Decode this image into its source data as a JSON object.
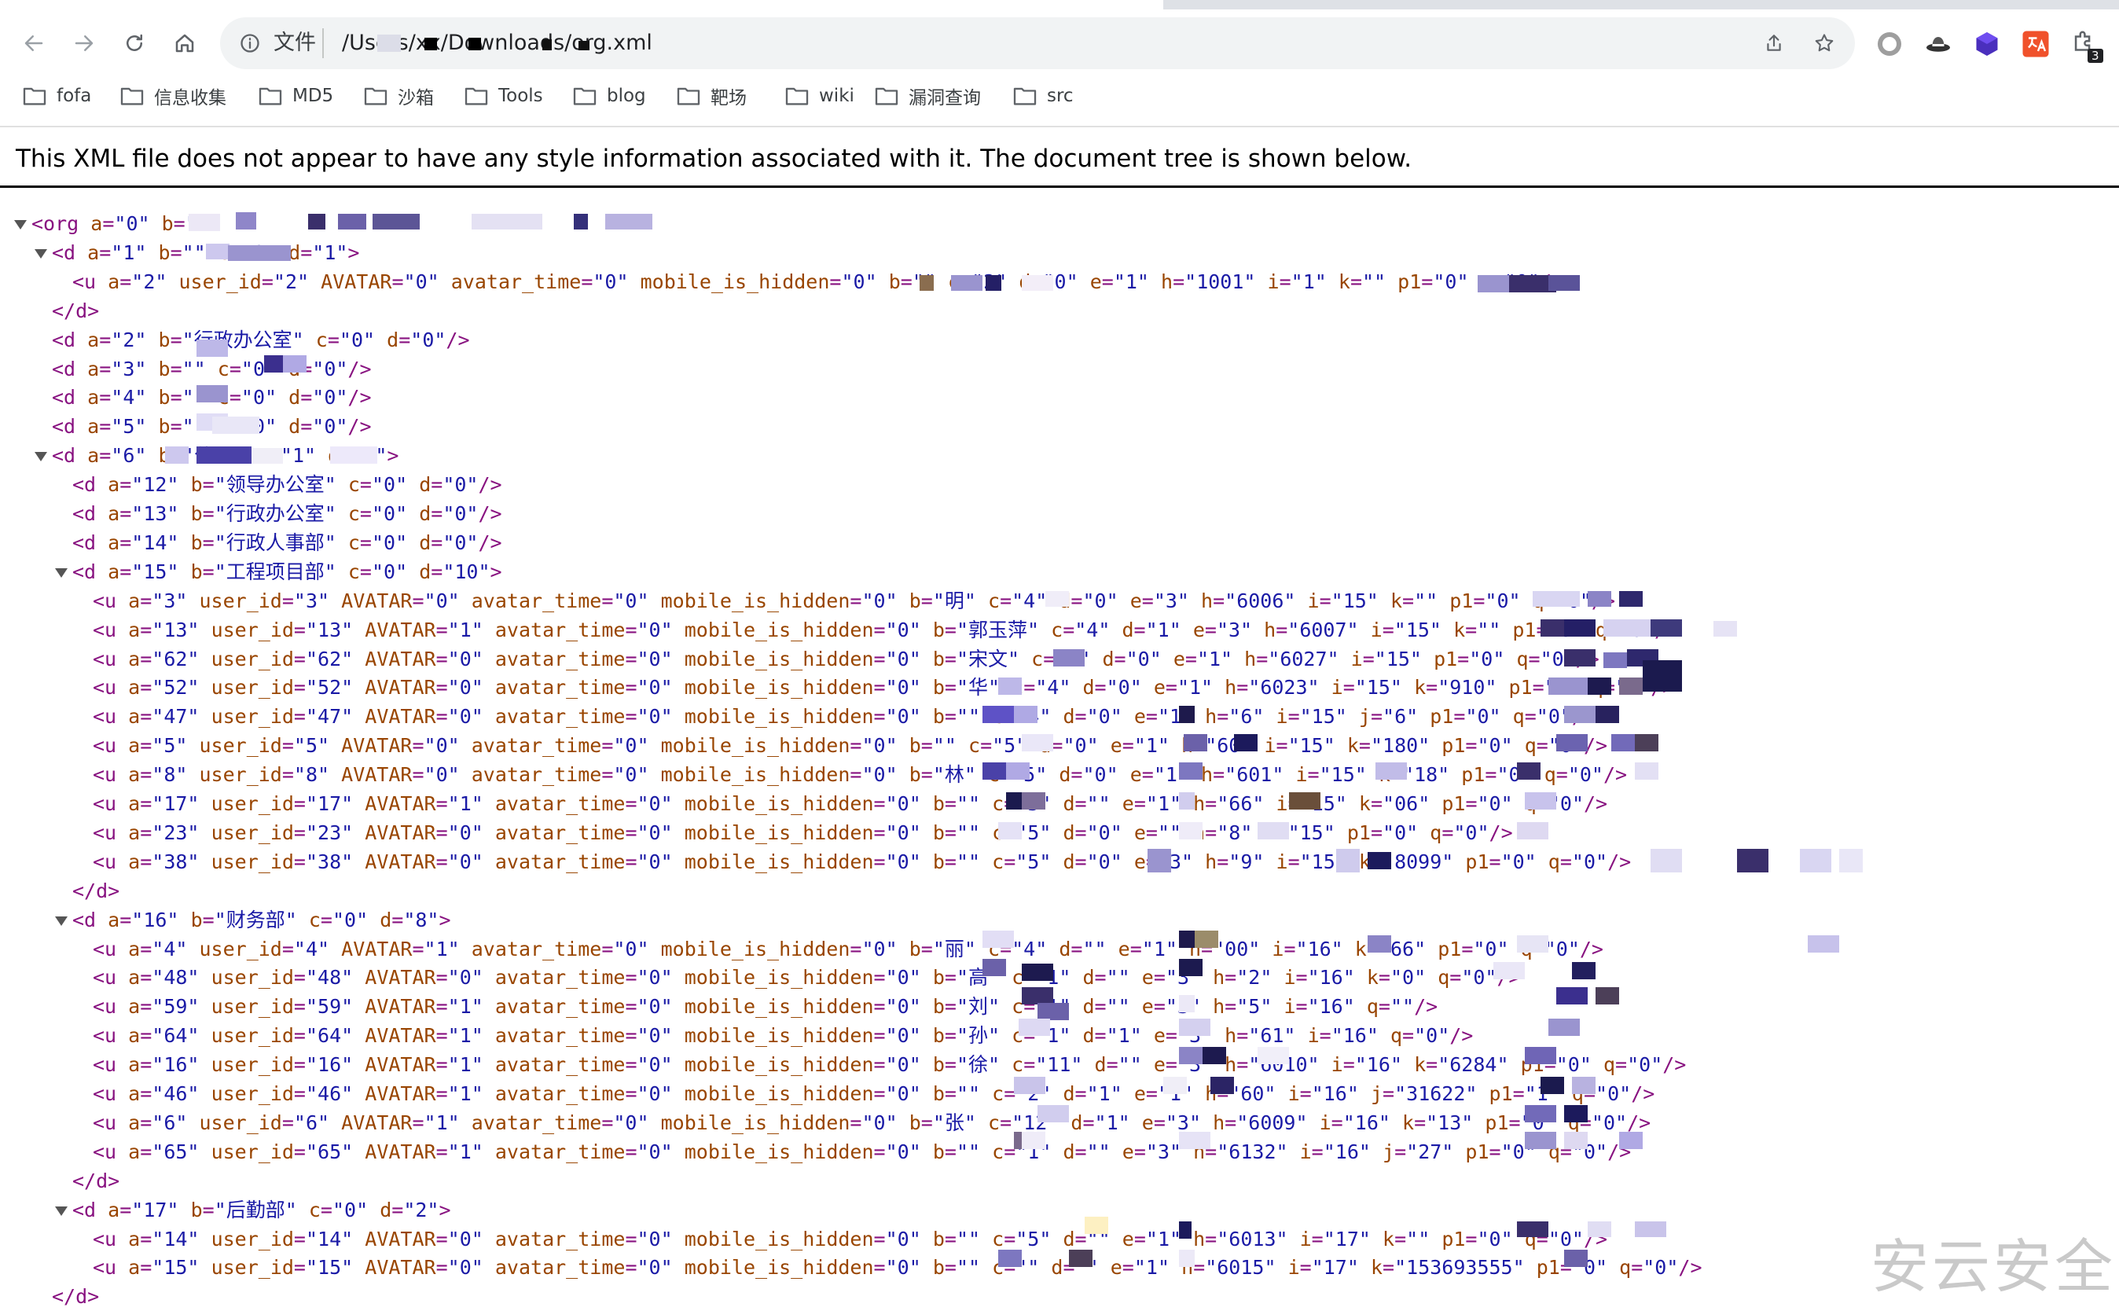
{
  "browser": {
    "omnibox": {
      "scheme_label": "文件",
      "url": "/Users/xx/Downloads/org.xml"
    },
    "bookmarks": [
      "fofa",
      "信息收集",
      "MD5",
      "沙箱",
      "Tools",
      "blog",
      "靶场",
      "wiki",
      "漏洞查询",
      "src"
    ],
    "extension_badge": "3"
  },
  "page": {
    "notice": "This XML file does not appear to have any style information associated with it. The document tree is shown below."
  },
  "xml_lines": [
    "<org a=\"0\" b=\"\">",
    "<d a=\"1\" b=\"\" c=\"0\" d=\"1\">",
    "<u a=\"2\" user_id=\"2\" AVATAR=\"0\" avatar_time=\"0\" mobile_is_hidden=\"0\" b=\"\" c=\"2\" d=\"0\" e=\"1\" h=\"1001\" i=\"1\" k=\"\" p1=\"0\" q=\"0\"/>",
    "</d>",
    "<d a=\"2\" b=\"行政办公室\" c=\"0\" d=\"0\"/>",
    "<d a=\"3\" b=\"\" c=\"0\" d=\"0\"/>",
    "<d a=\"4\" b=\"\" c=\"0\" d=\"0\"/>",
    "<d a=\"5\" b=\"\" c=\"0\" d=\"0\"/>",
    "<d a=\"6\" b=\"公司\" c=\"1\" d=\"0\">",
    "<d a=\"12\" b=\"领导办公室\" c=\"0\" d=\"0\"/>",
    "<d a=\"13\" b=\"行政办公室\" c=\"0\" d=\"0\"/>",
    "<d a=\"14\" b=\"行政人事部\" c=\"0\" d=\"0\"/>",
    "<d a=\"15\" b=\"工程项目部\" c=\"0\" d=\"10\">",
    "<u a=\"3\" user_id=\"3\" AVATAR=\"0\" avatar_time=\"0\" mobile_is_hidden=\"0\" b=\"明\" c=\"4\" d=\"0\" e=\"3\" h=\"6006\" i=\"15\" k=\"\" p1=\"0\" q=\"0\"/>",
    "<u a=\"13\" user_id=\"13\" AVATAR=\"1\" avatar_time=\"0\" mobile_is_hidden=\"0\" b=\"郭玉萍\" c=\"4\" d=\"1\" e=\"3\" h=\"6007\" i=\"15\" k=\"\" p1=\"0\" q=\"0\"/>",
    "<u a=\"62\" user_id=\"62\" AVATAR=\"0\" avatar_time=\"0\" mobile_is_hidden=\"0\" b=\"宋文\" c=\"4\" d=\"0\" e=\"1\" h=\"6027\" i=\"15\" p1=\"0\" q=\"0\"/>",
    "<u a=\"52\" user_id=\"52\" AVATAR=\"0\" avatar_time=\"0\" mobile_is_hidden=\"0\" b=\"华\" c=\"4\" d=\"0\" e=\"1\" h=\"6023\" i=\"15\" k=\"910\" p1=\"0\" q=\"0\"/>",
    "<u a=\"47\" user_id=\"47\" AVATAR=\"0\" avatar_time=\"0\" mobile_is_hidden=\"0\" b=\"\" c=\"4\" d=\"0\" e=\"1\" h=\"6\" i=\"15\" j=\"6\" p1=\"0\" q=\"0\"/>",
    "<u a=\"5\" user_id=\"5\" AVATAR=\"0\" avatar_time=\"0\" mobile_is_hidden=\"0\" b=\"\" c=\"5\" d=\"0\" e=\"1\" h=\"60\" i=\"15\" k=\"180\" p1=\"0\" q=\"0\"/>",
    "<u a=\"8\" user_id=\"8\" AVATAR=\"0\" avatar_time=\"0\" mobile_is_hidden=\"0\" b=\"林\" c=\"5\" d=\"0\" e=\"1\" h=\"601\" i=\"15\" k=\"18\" p1=\"0\" q=\"0\"/>",
    "<u a=\"17\" user_id=\"17\" AVATAR=\"1\" avatar_time=\"0\" mobile_is_hidden=\"0\" b=\"\" c=\"5\" d=\"\" e=\"1\" h=\"66\" i=\"15\" k=\"06\" p1=\"0\" q=\"0\"/>",
    "<u a=\"23\" user_id=\"23\" AVATAR=\"0\" avatar_time=\"0\" mobile_is_hidden=\"0\" b=\"\" c=\"5\" d=\"0\" e=\"\" h=\"8\" i=\"15\" p1=\"0\" q=\"0\"/>",
    "<u a=\"38\" user_id=\"38\" AVATAR=\"0\" avatar_time=\"0\" mobile_is_hidden=\"0\" b=\"\" c=\"5\" d=\"0\" e=\"3\" h=\"9\" i=\"15\" k=\"8099\" p1=\"0\" q=\"0\"/>",
    "</d>",
    "<d a=\"16\" b=\"财务部\" c=\"0\" d=\"8\">",
    "<u a=\"4\" user_id=\"4\" AVATAR=\"1\" avatar_time=\"0\" mobile_is_hidden=\"0\" b=\"丽\" c=\"4\" d=\"\" e=\"1\" h=\"00\" i=\"16\" k=\"66\" p1=\"0\" q=\"0\"/>",
    "<u a=\"48\" user_id=\"48\" AVATAR=\"0\" avatar_time=\"0\" mobile_is_hidden=\"0\" b=\"高\" c=\"1\" d=\"\" e=\"3\" h=\"2\" i=\"16\" k=\"0\" q=\"0\"/>",
    "<u a=\"59\" user_id=\"59\" AVATAR=\"1\" avatar_time=\"0\" mobile_is_hidden=\"0\" b=\"刘\" c=\"1\" d=\"\" e=\"3\" h=\"5\" i=\"16\" q=\"\"/>",
    "<u a=\"64\" user_id=\"64\" AVATAR=\"1\" avatar_time=\"0\" mobile_is_hidden=\"0\" b=\"孙\" c=\"1\" d=\"1\" e=\"3\" h=\"61\" i=\"16\" q=\"0\"/>",
    "<u a=\"16\" user_id=\"16\" AVATAR=\"1\" avatar_time=\"0\" mobile_is_hidden=\"0\" b=\"徐\" c=\"11\" d=\"\" e=\"3\" h=\"6010\" i=\"16\" k=\"6284\" p1=\"0\" q=\"0\"/>",
    "<u a=\"46\" user_id=\"46\" AVATAR=\"1\" avatar_time=\"0\" mobile_is_hidden=\"0\" b=\"\" c=\"2\" d=\"1\" e=\"1\" h=\"60\" i=\"16\" j=\"31622\" p1=\"1\" q=\"0\"/>",
    "<u a=\"6\" user_id=\"6\" AVATAR=\"1\" avatar_time=\"0\" mobile_is_hidden=\"0\" b=\"张\" c=\"12\" d=\"1\" e=\"3\" h=\"6009\" i=\"16\" k=\"13\" p1=\"0\" q=\"0\"/>",
    "<u a=\"65\" user_id=\"65\" AVATAR=\"1\" avatar_time=\"0\" mobile_is_hidden=\"0\" b=\"\" c=\"1\" d=\"\" e=\"3\" h=\"6132\" i=\"16\" j=\"27\" p1=\"0\" q=\"0\"/>",
    "</d>",
    "<d a=\"17\" b=\"后勤部\" c=\"0\" d=\"2\">",
    "<u a=\"14\" user_id=\"14\" AVATAR=\"0\" avatar_time=\"0\" mobile_is_hidden=\"0\" b=\"\" c=\"5\" d=\"\" e=\"1\" h=\"6013\" i=\"17\" k=\"\" p1=\"0\" q=\"0\"/>",
    "<u a=\"15\" user_id=\"15\" AVATAR=\"0\" avatar_time=\"0\" mobile_is_hidden=\"0\" b=\"\" c=\"\" d=\"\" e=\"1\" h=\"6015\" i=\"17\" k=\"153693555\" p1=\"0\" q=\"0\"/>",
    "</d>"
  ],
  "watermark": "安云安全"
}
